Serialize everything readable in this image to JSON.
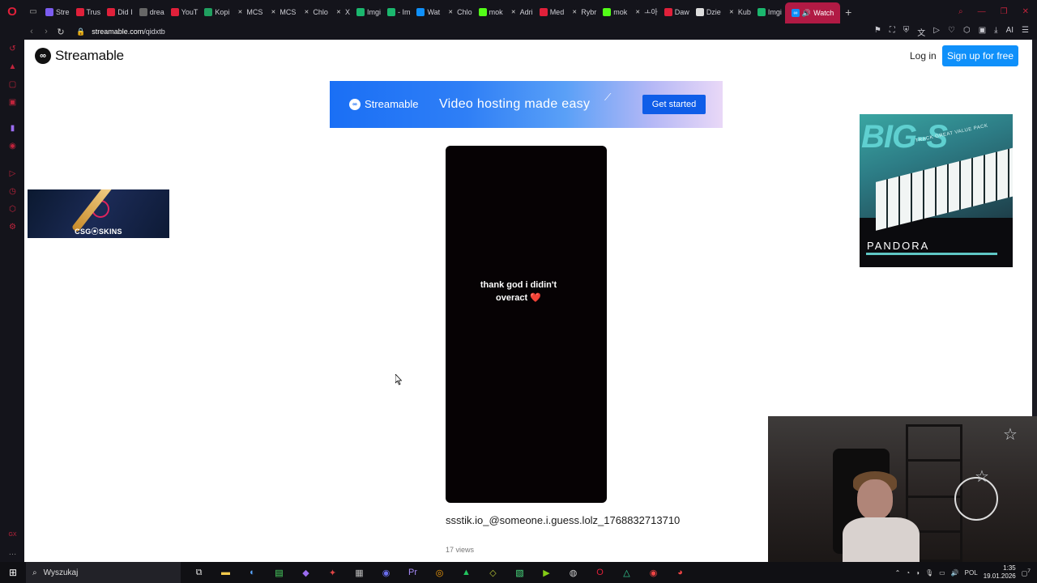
{
  "browser": {
    "tabs": [
      {
        "label": "Stre",
        "icon": "twitch-icon",
        "color": "#7b5cf0"
      },
      {
        "label": "Trus",
        "icon": "youtube-icon",
        "color": "#e0203a"
      },
      {
        "label": "Did I",
        "icon": "youtube-icon",
        "color": "#e0203a"
      },
      {
        "label": "drea",
        "icon": "page-icon",
        "color": "#666666"
      },
      {
        "label": "YouT",
        "icon": "youtube-icon",
        "color": "#e0203a"
      },
      {
        "label": "Kopi",
        "icon": "sheets-icon",
        "color": "#20a060"
      },
      {
        "label": "MCS",
        "icon": "x-icon",
        "color": "#dddddd"
      },
      {
        "label": "MCS",
        "icon": "x-icon",
        "color": "#dddddd"
      },
      {
        "label": "Chlo",
        "icon": "x-icon",
        "color": "#dddddd"
      },
      {
        "label": "X",
        "icon": "x-icon",
        "color": "#dddddd"
      },
      {
        "label": "Imgi",
        "icon": "imgur-icon",
        "color": "#1bb76e"
      },
      {
        "label": "- Im",
        "icon": "imgur-icon",
        "color": "#1bb76e"
      },
      {
        "label": "Wat",
        "icon": "streamable-icon",
        "color": "#0f90fa"
      },
      {
        "label": "Chlo",
        "icon": "x-icon",
        "color": "#dddddd"
      },
      {
        "label": "mok",
        "icon": "kick-icon",
        "color": "#53fc18"
      },
      {
        "label": "Adri",
        "icon": "x-icon",
        "color": "#dddddd"
      },
      {
        "label": "Med",
        "icon": "youtube-icon",
        "color": "#e0203a"
      },
      {
        "label": "Rybr",
        "icon": "x-icon",
        "color": "#dddddd"
      },
      {
        "label": "mok",
        "icon": "kick-icon",
        "color": "#53fc18"
      },
      {
        "label": "ㅗ아",
        "icon": "x-icon",
        "color": "#dddddd"
      },
      {
        "label": "Daw",
        "icon": "youtube-icon",
        "color": "#e0203a"
      },
      {
        "label": "Dzie",
        "icon": "tiktok-icon",
        "color": "#dddddd"
      },
      {
        "label": "Kub",
        "icon": "x-icon",
        "color": "#dddddd"
      },
      {
        "label": "Imgi",
        "icon": "imgur-icon",
        "color": "#1bb76e"
      }
    ],
    "active_tab": {
      "label": "Watch",
      "icon": "streamable-icon"
    },
    "url_host": "streamable.com",
    "url_path": "/qidxtb"
  },
  "page": {
    "brand": "Streamable",
    "login": "Log in",
    "signup": "Sign up for free",
    "banner": {
      "logo_text": "Streamable",
      "headline": "Video hosting made easy",
      "cta": "Get started"
    },
    "ad_left": {
      "text": "CSG⦿SKINS"
    },
    "ad_right": {
      "big": "BIG-S",
      "sub": "TRACK GREAT VALUE PACK",
      "brand": "PANDORA"
    },
    "video": {
      "caption_line1": "thank god i didin't",
      "caption_line2": "overact",
      "caption_emoji": "❤️",
      "title": "ssstik.io_@someone.i.guess.lolz_1768832713710",
      "views": "17 views"
    }
  },
  "taskbar": {
    "search_placeholder": "Wyszukaj",
    "language": "POL",
    "time": "1:35",
    "date": "19.01.2026",
    "notification_count": "7"
  },
  "colors": {
    "accent_blue": "#0f90fa",
    "opera_red": "#e0203a"
  }
}
